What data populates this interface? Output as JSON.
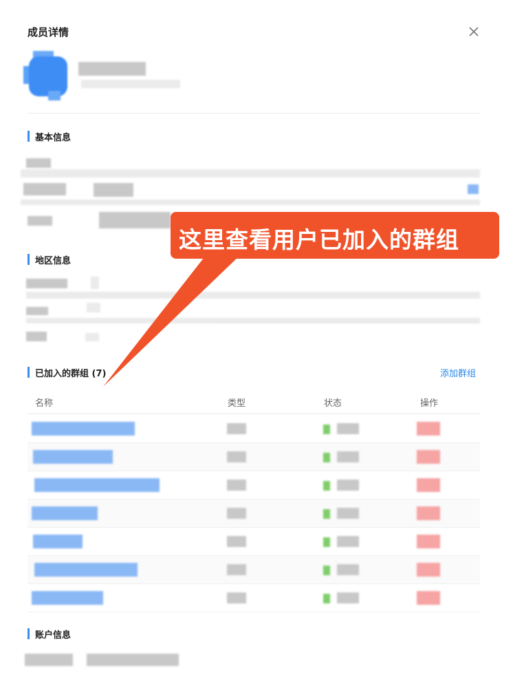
{
  "dialog": {
    "title": "成员详情"
  },
  "sections": {
    "basic_info": "基本信息",
    "region_info": "地区信息",
    "joined_groups": "已加入的群组 (7)",
    "account_info": "账户信息"
  },
  "groups": {
    "add_label": "添加群组",
    "columns": [
      "名称",
      "类型",
      "状态",
      "操作"
    ],
    "row_count": 7
  },
  "callout": {
    "text": "这里查看用户已加入的群组"
  },
  "colors": {
    "accent": "#3b8ef0",
    "link": "#2b88e8",
    "callout": "#f0522a"
  },
  "icons": {
    "close": "close-icon"
  }
}
